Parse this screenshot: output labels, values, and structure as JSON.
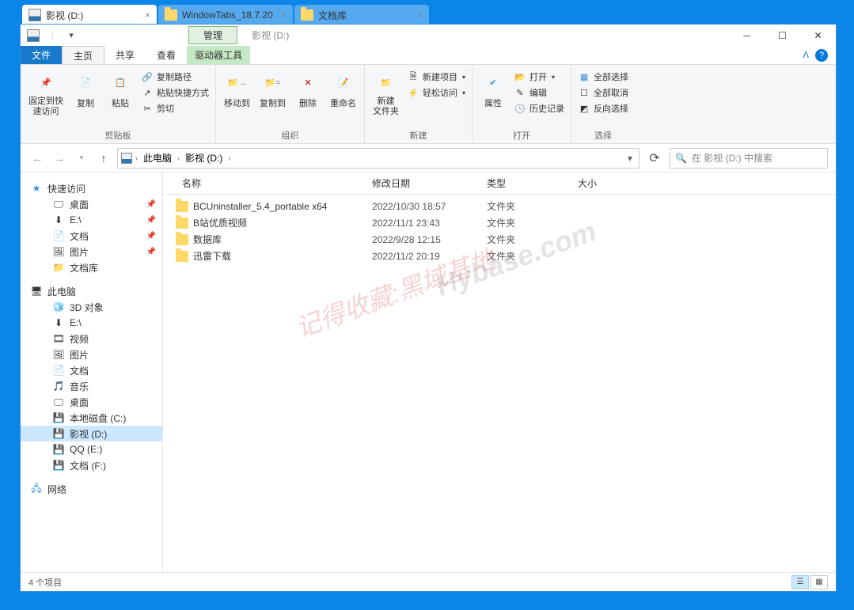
{
  "window_tabs": [
    {
      "label": "影视 (D:)",
      "active": true,
      "icon": "drive"
    },
    {
      "label": "WindowTabs_18.7.20",
      "active": false,
      "icon": "folder"
    },
    {
      "label": "文档库",
      "active": false,
      "icon": "folder"
    }
  ],
  "titlebar": {
    "management_label": "管理",
    "address_title": "影视 (D:)"
  },
  "tabs": {
    "file": "文件",
    "home": "主页",
    "share": "共享",
    "view": "查看",
    "drive_tools": "驱动器工具"
  },
  "ribbon": {
    "clipboard": {
      "pin": "固定到快\n速访问",
      "copy": "复制",
      "paste": "粘贴",
      "copy_path": "复制路径",
      "paste_shortcut": "粘贴快捷方式",
      "cut": "剪切",
      "group": "剪贴板"
    },
    "organize": {
      "move_to": "移动到",
      "copy_to": "复制到",
      "delete": "删除",
      "rename": "重命名",
      "group": "组织"
    },
    "new": {
      "new_folder": "新建\n文件夹",
      "new_item": "新建项目",
      "easy_access": "轻松访问",
      "group": "新建"
    },
    "open": {
      "properties": "属性",
      "open": "打开",
      "edit": "编辑",
      "history": "历史记录",
      "group": "打开"
    },
    "select": {
      "select_all": "全部选择",
      "select_none": "全部取消",
      "invert": "反向选择",
      "group": "选择"
    }
  },
  "address": {
    "this_pc": "此电脑",
    "current": "影视 (D:)"
  },
  "search": {
    "placeholder": "在 影视 (D:) 中搜索"
  },
  "sidebar": {
    "quick_access": "快速访问",
    "quick_items": [
      {
        "label": "桌面",
        "icon": "desktop",
        "pinned": true
      },
      {
        "label": "E:\\",
        "icon": "drive-arrow",
        "pinned": true
      },
      {
        "label": "文档",
        "icon": "doc",
        "pinned": true
      },
      {
        "label": "图片",
        "icon": "pic",
        "pinned": true
      },
      {
        "label": "文档库",
        "icon": "folder",
        "pinned": false
      }
    ],
    "this_pc": "此电脑",
    "pc_items": [
      {
        "label": "3D 对象",
        "icon": "3d"
      },
      {
        "label": "E:\\",
        "icon": "drive-arrow"
      },
      {
        "label": "视频",
        "icon": "video"
      },
      {
        "label": "图片",
        "icon": "pic"
      },
      {
        "label": "文档",
        "icon": "doc"
      },
      {
        "label": "音乐",
        "icon": "music"
      },
      {
        "label": "桌面",
        "icon": "desktop"
      },
      {
        "label": "本地磁盘 (C:)",
        "icon": "drive"
      },
      {
        "label": "影视 (D:)",
        "icon": "drive",
        "selected": true
      },
      {
        "label": "QQ (E:)",
        "icon": "drive"
      },
      {
        "label": "文档 (F:)",
        "icon": "drive"
      }
    ],
    "network": "网络"
  },
  "columns": {
    "name": "名称",
    "date": "修改日期",
    "type": "类型",
    "size": "大小"
  },
  "files": [
    {
      "name": "BCUninstaller_5.4_portable x64",
      "date": "2022/10/30 18:57",
      "type": "文件夹"
    },
    {
      "name": "B站优质视频",
      "date": "2022/11/1 23:43",
      "type": "文件夹"
    },
    {
      "name": "数据库",
      "date": "2022/9/28 12:15",
      "type": "文件夹"
    },
    {
      "name": "迅雷下载",
      "date": "2022/11/2 20:19",
      "type": "文件夹"
    }
  ],
  "status": {
    "items": "4 个项目"
  },
  "watermark": {
    "a": "记得收藏:黑域基地",
    "b": "Hybase.com"
  }
}
